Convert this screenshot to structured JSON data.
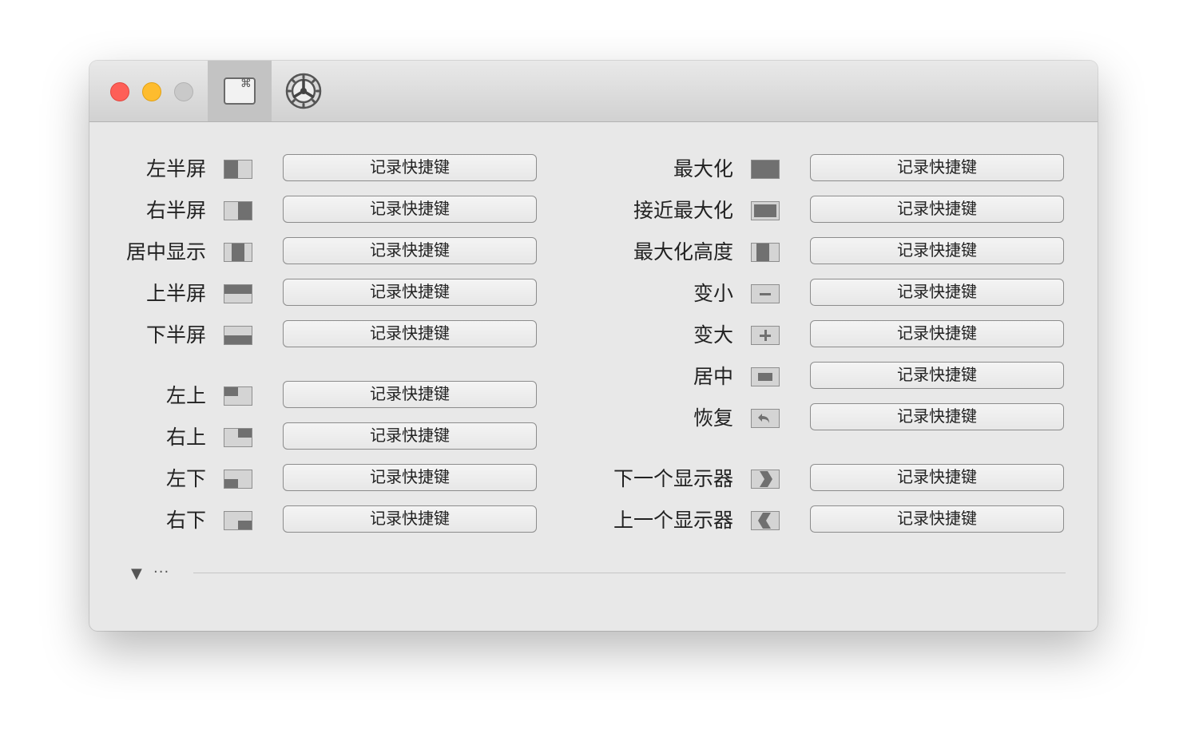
{
  "window": {
    "toolbar": {
      "tabs": [
        {
          "name": "shortcuts",
          "icon": "command-key-icon",
          "glyph": "⌘",
          "selected": true
        },
        {
          "name": "general",
          "icon": "gear-icon",
          "selected": false
        }
      ]
    },
    "record_label": "记录快捷键",
    "left_items": [
      {
        "label": "左半屏",
        "icon": "left-half"
      },
      {
        "label": "右半屏",
        "icon": "right-half"
      },
      {
        "label": "居中显示",
        "icon": "center-third"
      },
      {
        "label": "上半屏",
        "icon": "top-half"
      },
      {
        "label": "下半屏",
        "icon": "bottom-half"
      },
      {
        "label": "左上",
        "icon": "top-left"
      },
      {
        "label": "右上",
        "icon": "top-right"
      },
      {
        "label": "左下",
        "icon": "bottom-left"
      },
      {
        "label": "右下",
        "icon": "bottom-right"
      }
    ],
    "right_items": [
      {
        "label": "最大化",
        "icon": "maximize"
      },
      {
        "label": "接近最大化",
        "icon": "almost-maximize"
      },
      {
        "label": "最大化高度",
        "icon": "maximize-height"
      },
      {
        "label": "变小",
        "icon": "smaller"
      },
      {
        "label": "变大",
        "icon": "larger"
      },
      {
        "label": "居中",
        "icon": "center"
      },
      {
        "label": "恢复",
        "icon": "restore"
      },
      {
        "label": "下一个显示器",
        "icon": "next-display"
      },
      {
        "label": "上一个显示器",
        "icon": "previous-display"
      }
    ],
    "more": {
      "disclosure": "▼",
      "ellipsis": "···"
    }
  }
}
